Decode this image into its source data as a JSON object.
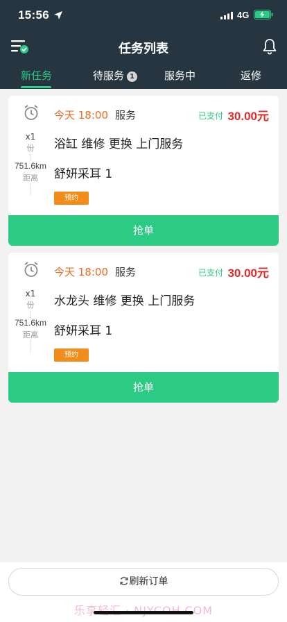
{
  "status_bar": {
    "time": "15:56",
    "network": "4G"
  },
  "header": {
    "title": "任务列表"
  },
  "tabs": [
    {
      "label": "新任务",
      "active": true
    },
    {
      "label": "待服务",
      "badge": "1"
    },
    {
      "label": "服务中"
    },
    {
      "label": "返修"
    }
  ],
  "orders": [
    {
      "time_label": "今天 18:00",
      "service_suffix": "服务",
      "paid_label": "已支付",
      "price": "30.00元",
      "quantity": "x1",
      "quantity_unit": "份",
      "service_name": "浴缸 维修 更换 上门服务",
      "distance": "751.6km",
      "distance_label": "距离",
      "customer": "舒妍采耳 1",
      "tag": "预约",
      "action_label": "抢单"
    },
    {
      "time_label": "今天 18:00",
      "service_suffix": "服务",
      "paid_label": "已支付",
      "price": "30.00元",
      "quantity": "x1",
      "quantity_unit": "份",
      "service_name": "水龙头 维修 更换 上门服务",
      "distance": "751.6km",
      "distance_label": "距离",
      "customer": "舒妍采耳 1",
      "tag": "预约",
      "action_label": "抢单"
    }
  ],
  "footer": {
    "refresh_label": "刷新订单",
    "watermark": "乐享轻汇 · NJYCOH.COM"
  },
  "colors": {
    "header_bg": "#263540",
    "accent_green": "#2bcb86",
    "time_orange": "#ef6c1e",
    "price_red": "#e02b2b",
    "tag_orange": "#f28c1a"
  }
}
